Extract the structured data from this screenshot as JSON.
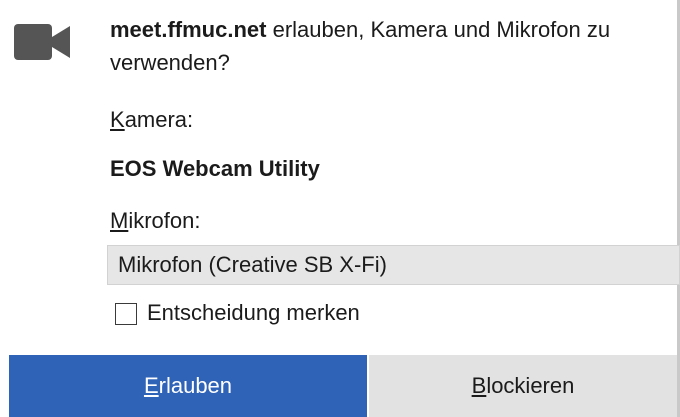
{
  "prompt": {
    "host": "meet.ffmuc.net",
    "message_rest": " erlauben, Kamera und Mikrofon zu verwenden?"
  },
  "camera": {
    "label_access": "K",
    "label_rest": "amera:",
    "value": "EOS Webcam Utility"
  },
  "microphone": {
    "label_access": "M",
    "label_rest": "ikrofon:",
    "selected": "Mikrofon (Creative SB X-Fi)"
  },
  "remember": {
    "label": "Entscheidung merken",
    "checked": false
  },
  "buttons": {
    "allow_access": "E",
    "allow_rest": "rlauben",
    "block_access": "B",
    "block_rest": "lockieren"
  },
  "colors": {
    "allow_button": "#2f63b8",
    "block_button": "#e2e2e2",
    "select_background": "#e6e6e6"
  },
  "icons": {
    "camera": "video-camera-icon"
  }
}
